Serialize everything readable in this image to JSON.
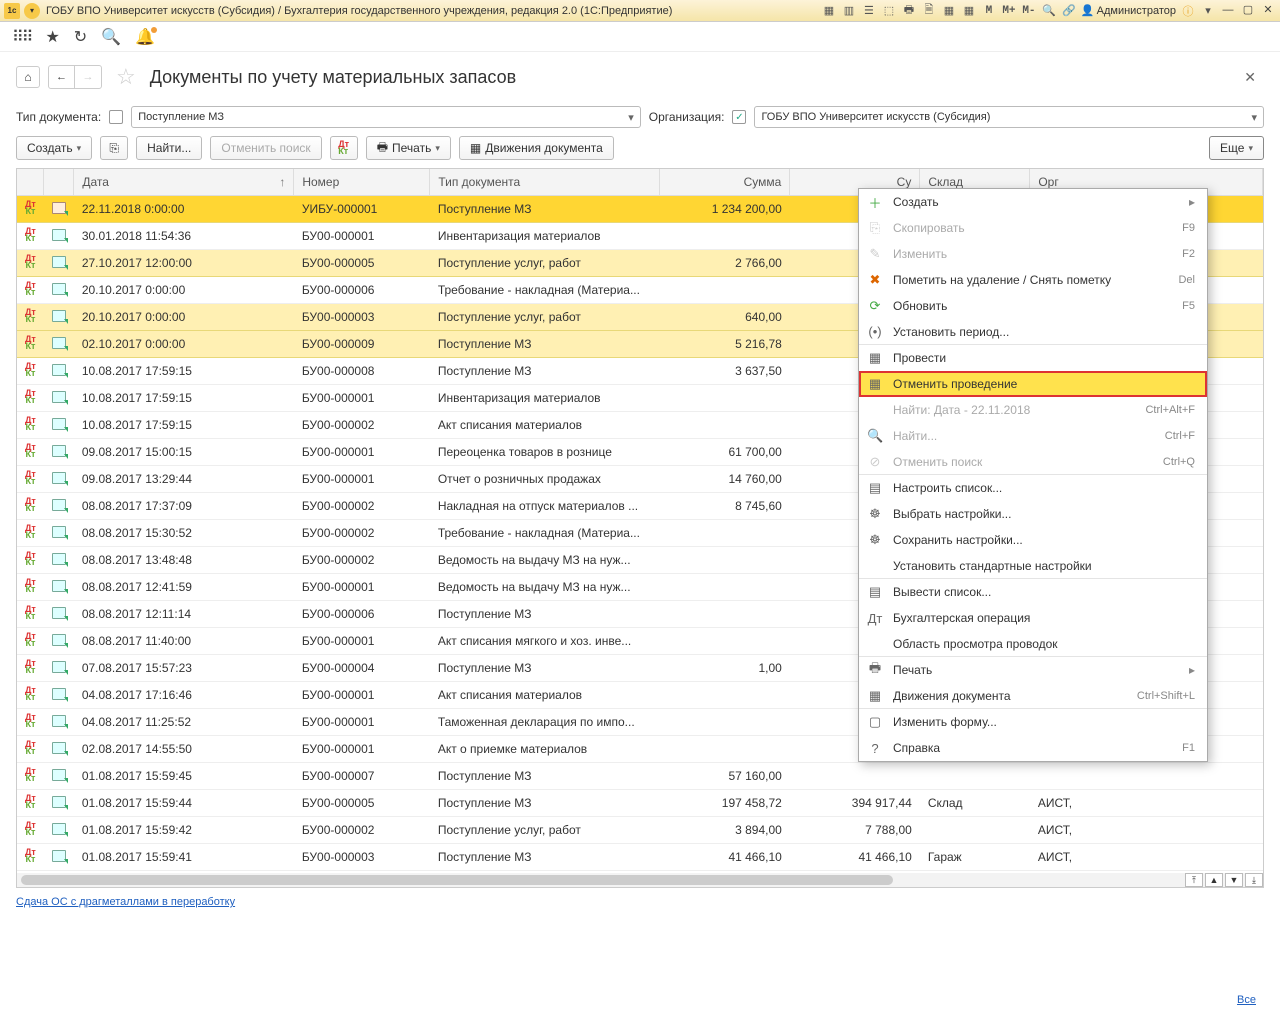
{
  "title": "ГОБУ ВПО Университет искусств (Субсидия) / Бухгалтерия государственного учреждения, редакция 2.0  (1С:Предприятие)",
  "admin_label": "Администратор",
  "page_heading": "Документы по учету материальных запасов",
  "filters": {
    "doc_type_label": "Тип документа:",
    "doc_type_value": "Поступление МЗ",
    "org_label": "Организация:",
    "org_value": "ГОБУ ВПО Университет искусств (Субсидия)"
  },
  "cmd": {
    "create": "Создать",
    "find": "Найти...",
    "cancel_search": "Отменить поиск",
    "print": "Печать",
    "movements": "Движения документа",
    "more": "Еще"
  },
  "columns": {
    "date": "Дата",
    "number": "Номер",
    "type": "Тип документа",
    "sum": "Сумма",
    "sum2": "Су",
    "store": "Склад",
    "org": "Орг"
  },
  "rows": [
    {
      "yl": true,
      "sel": true,
      "date": "22.11.2018 0:00:00",
      "num": "УИБУ-000001",
      "type": "Поступление МЗ",
      "sum": "1 234 200,00",
      "sum2": "",
      "store": "",
      "org": ""
    },
    {
      "yl": false,
      "date": "30.01.2018 11:54:36",
      "num": "БУ00-000001",
      "type": "Инвентаризация материалов",
      "sum": "",
      "sum2": "",
      "store": "",
      "org": ""
    },
    {
      "yl": true,
      "date": "27.10.2017 12:00:00",
      "num": "БУ00-000005",
      "type": "Поступление услуг, работ",
      "sum": "2 766,00",
      "sum2": "",
      "store": "",
      "org": ""
    },
    {
      "yl": false,
      "date": "20.10.2017 0:00:00",
      "num": "БУ00-000006",
      "type": "Требование - накладная (Материа...",
      "sum": "",
      "sum2": "",
      "store": "",
      "org": ""
    },
    {
      "yl": true,
      "date": "20.10.2017 0:00:00",
      "num": "БУ00-000003",
      "type": "Поступление услуг, работ",
      "sum": "640,00",
      "sum2": "",
      "store": "",
      "org": ""
    },
    {
      "yl": true,
      "date": "02.10.2017 0:00:00",
      "num": "БУ00-000009",
      "type": "Поступление МЗ",
      "sum": "5 216,78",
      "sum2": "",
      "store": "",
      "org": ""
    },
    {
      "yl": false,
      "date": "10.08.2017 17:59:15",
      "num": "БУ00-000008",
      "type": "Поступление МЗ",
      "sum": "3 637,50",
      "sum2": "",
      "store": "",
      "org": ""
    },
    {
      "yl": false,
      "date": "10.08.2017 17:59:15",
      "num": "БУ00-000001",
      "type": "Инвентаризация материалов",
      "sum": "",
      "sum2": "",
      "store": "",
      "org": ""
    },
    {
      "yl": false,
      "date": "10.08.2017 17:59:15",
      "num": "БУ00-000002",
      "type": "Акт списания материалов",
      "sum": "",
      "sum2": "",
      "store": "",
      "org": ""
    },
    {
      "yl": false,
      "date": "09.08.2017 15:00:15",
      "num": "БУ00-000001",
      "type": "Переоценка товаров в рознице",
      "sum": "61 700,00",
      "sum2": "",
      "store": "",
      "org": ""
    },
    {
      "yl": false,
      "date": "09.08.2017 13:29:44",
      "num": "БУ00-000001",
      "type": "Отчет о розничных продажах",
      "sum": "14 760,00",
      "sum2": "",
      "store": "",
      "org": ""
    },
    {
      "yl": false,
      "date": "08.08.2017 17:37:09",
      "num": "БУ00-000002",
      "type": "Накладная на отпуск материалов ...",
      "sum": "8 745,60",
      "sum2": "",
      "store": "",
      "org": ""
    },
    {
      "yl": false,
      "date": "08.08.2017 15:30:52",
      "num": "БУ00-000002",
      "type": "Требование - накладная (Материа...",
      "sum": "",
      "sum2": "",
      "store": "",
      "org": ""
    },
    {
      "yl": false,
      "date": "08.08.2017 13:48:48",
      "num": "БУ00-000002",
      "type": "Ведомость на выдачу МЗ на нуж...",
      "sum": "",
      "sum2": "",
      "store": "",
      "org": ""
    },
    {
      "yl": false,
      "date": "08.08.2017 12:41:59",
      "num": "БУ00-000001",
      "type": "Ведомость на выдачу МЗ на нуж...",
      "sum": "",
      "sum2": "",
      "store": "",
      "org": ""
    },
    {
      "yl": false,
      "date": "08.08.2017 12:11:14",
      "num": "БУ00-000006",
      "type": "Поступление МЗ",
      "sum": "",
      "sum2": "",
      "store": "",
      "org": ""
    },
    {
      "yl": false,
      "date": "08.08.2017 11:40:00",
      "num": "БУ00-000001",
      "type": "Акт списания мягкого и хоз. инве...",
      "sum": "",
      "sum2": "",
      "store": "",
      "org": ""
    },
    {
      "yl": false,
      "date": "07.08.2017 15:57:23",
      "num": "БУ00-000004",
      "type": "Поступление МЗ",
      "sum": "1,00",
      "sum2": "",
      "store": "",
      "org": ""
    },
    {
      "yl": false,
      "date": "04.08.2017 17:16:46",
      "num": "БУ00-000001",
      "type": "Акт списания материалов",
      "sum": "",
      "sum2": "",
      "store": "",
      "org": ""
    },
    {
      "yl": false,
      "date": "04.08.2017 11:25:52",
      "num": "БУ00-000001",
      "type": "Таможенная декларация по импо...",
      "sum": "",
      "sum2": "",
      "store": "",
      "org": ""
    },
    {
      "yl": false,
      "date": "02.08.2017 14:55:50",
      "num": "БУ00-000001",
      "type": "Акт о приемке материалов",
      "sum": "",
      "sum2": "",
      "store": "",
      "org": ""
    },
    {
      "yl": false,
      "date": "01.08.2017 15:59:45",
      "num": "БУ00-000007",
      "type": "Поступление МЗ",
      "sum": "57 160,00",
      "sum2": "",
      "store": "",
      "org": ""
    },
    {
      "yl": false,
      "date": "01.08.2017 15:59:44",
      "num": "БУ00-000005",
      "type": "Поступление МЗ",
      "sum": "197 458,72",
      "sum2": "394 917,44",
      "store": "Склад",
      "org": "АИСТ,"
    },
    {
      "yl": false,
      "date": "01.08.2017 15:59:42",
      "num": "БУ00-000002",
      "type": "Поступление услуг, работ",
      "sum": "3 894,00",
      "sum2": "7 788,00",
      "store": "",
      "org": "АИСТ,"
    },
    {
      "yl": false,
      "date": "01.08.2017 15:59:41",
      "num": "БУ00-000003",
      "type": "Поступление МЗ",
      "sum": "41 466,10",
      "sum2": "41 466,10",
      "store": "Гараж",
      "org": "АИСТ,"
    }
  ],
  "menu": [
    {
      "ic": "＋",
      "cls": "green",
      "lbl": "Создать",
      "sc": "",
      "sub": true
    },
    {
      "ic": "⎘",
      "lbl": "Скопировать",
      "sc": "F9",
      "dis": true
    },
    {
      "ic": "✎",
      "lbl": "Изменить",
      "sc": "F2",
      "dis": true
    },
    {
      "ic": "✖",
      "cls": "orange",
      "lbl": "Пометить на удаление / Снять пометку",
      "sc": "Del"
    },
    {
      "ic": "⟳",
      "cls": "green",
      "lbl": "Обновить",
      "sc": "F5"
    },
    {
      "ic": "(•)",
      "lbl": "Установить период...",
      "sep": true
    },
    {
      "ic": "▦",
      "lbl": "Провести"
    },
    {
      "ic": "▦",
      "lbl": "Отменить проведение",
      "hl": true,
      "sep": true
    },
    {
      "ic": "",
      "lbl": "Найти: Дата - 22.11.2018",
      "sc": "Ctrl+Alt+F",
      "dis": true
    },
    {
      "ic": "🔍",
      "lbl": "Найти...",
      "sc": "Ctrl+F",
      "dis": true
    },
    {
      "ic": "⊘",
      "lbl": "Отменить поиск",
      "sc": "Ctrl+Q",
      "dis": true,
      "sep": true
    },
    {
      "ic": "▤",
      "lbl": "Настроить список..."
    },
    {
      "ic": "☸",
      "lbl": "Выбрать настройки..."
    },
    {
      "ic": "☸",
      "lbl": "Сохранить настройки..."
    },
    {
      "ic": "",
      "lbl": "Установить стандартные настройки",
      "sep": true
    },
    {
      "ic": "▤",
      "lbl": "Вывести список..."
    },
    {
      "ic": "Дт",
      "lbl": "Бухгалтерская операция"
    },
    {
      "ic": "",
      "lbl": "Область просмотра проводок",
      "sep": true
    },
    {
      "ic": "🖶",
      "lbl": "Печать",
      "sub": true
    },
    {
      "ic": "▦",
      "lbl": "Движения документа",
      "sc": "Ctrl+Shift+L",
      "sep": true
    },
    {
      "ic": "▢",
      "lbl": "Изменить форму..."
    },
    {
      "ic": "?",
      "lbl": "Справка",
      "sc": "F1"
    }
  ],
  "footer_link": "Сдача ОС с драгметаллами в переработку",
  "footer_all": "Все"
}
